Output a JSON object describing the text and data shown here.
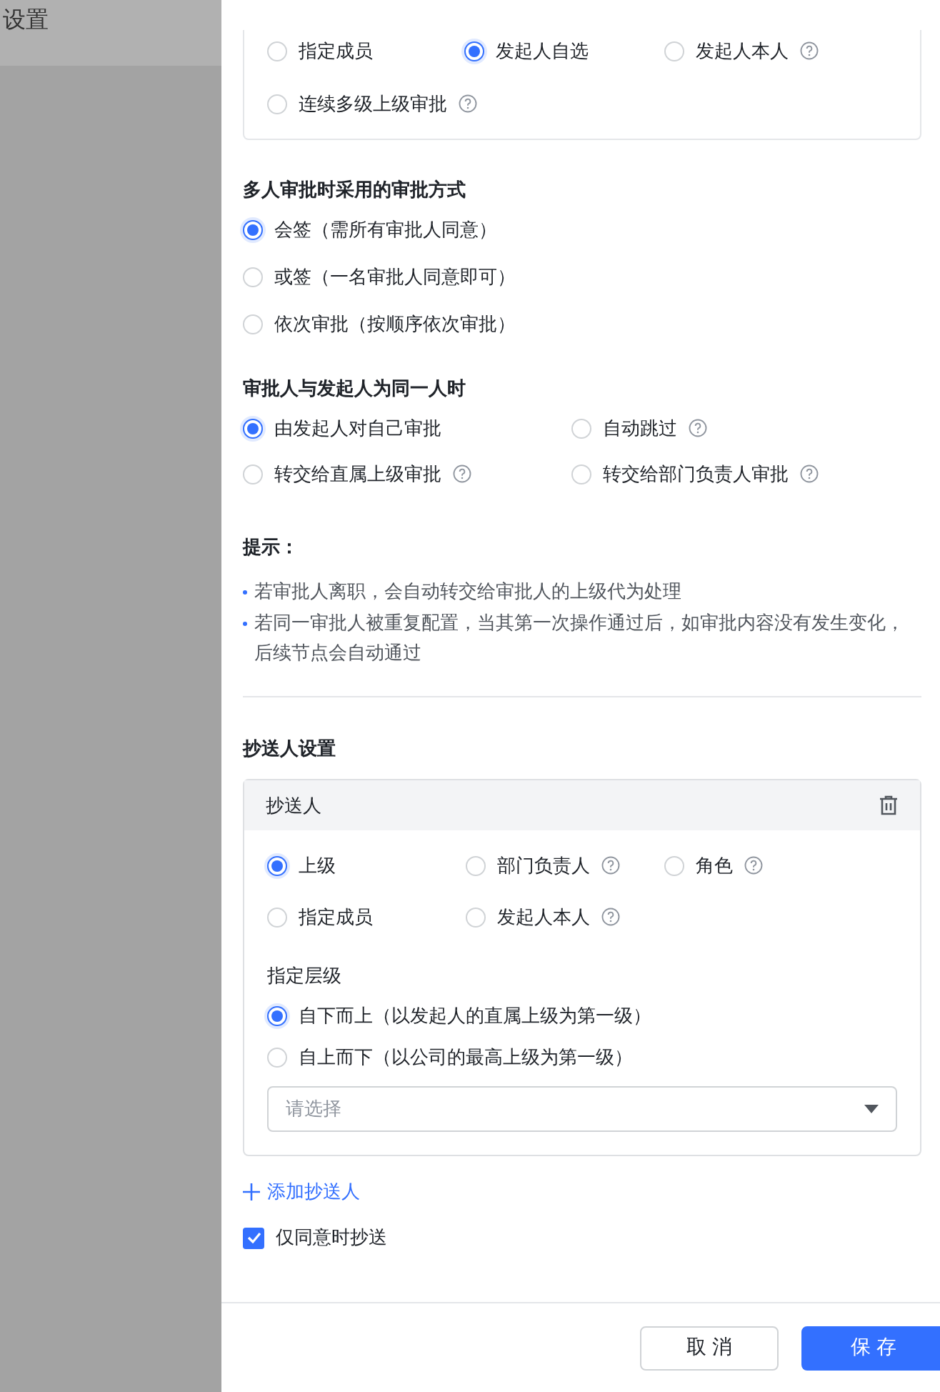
{
  "background_page": {
    "title": "设置"
  },
  "approver_types": {
    "options": [
      {
        "label": "指定成员",
        "selected": false,
        "help": false
      },
      {
        "label": "发起人自选",
        "selected": true,
        "help": false
      },
      {
        "label": "发起人本人",
        "selected": false,
        "help": true
      },
      {
        "label": "连续多级上级审批",
        "selected": false,
        "help": true
      }
    ]
  },
  "multi_approval": {
    "title": "多人审批时采用的审批方式",
    "options": [
      {
        "label": "会签（需所有审批人同意）",
        "selected": true
      },
      {
        "label": "或签（一名审批人同意即可）",
        "selected": false
      },
      {
        "label": "依次审批（按顺序依次审批）",
        "selected": false
      }
    ]
  },
  "same_person": {
    "title": "审批人与发起人为同一人时",
    "options": [
      {
        "label": "由发起人对自己审批",
        "selected": true,
        "help": false
      },
      {
        "label": "自动跳过",
        "selected": false,
        "help": true
      },
      {
        "label": "转交给直属上级审批",
        "selected": false,
        "help": true
      },
      {
        "label": "转交给部门负责人审批",
        "selected": false,
        "help": true
      }
    ]
  },
  "tips": {
    "title": "提示：",
    "items": [
      "若审批人离职，会自动转交给审批人的上级代为处理",
      "若同一审批人被重复配置，当其第一次操作通过后，如审批内容没有发生变化，后续节点会自动通过"
    ]
  },
  "cc": {
    "title": "抄送人设置",
    "card": {
      "title": "抄送人",
      "types": [
        {
          "label": "上级",
          "selected": true,
          "help": false
        },
        {
          "label": "部门负责人",
          "selected": false,
          "help": true
        },
        {
          "label": "角色",
          "selected": false,
          "help": true
        },
        {
          "label": "指定成员",
          "selected": false,
          "help": false
        },
        {
          "label": "发起人本人",
          "selected": false,
          "help": true
        }
      ],
      "level_title": "指定层级",
      "levels": [
        {
          "label": "自下而上（以发起人的直属上级为第一级）",
          "selected": true
        },
        {
          "label": "自上而下（以公司的最高上级为第一级）",
          "selected": false
        }
      ],
      "select": {
        "placeholder": "请选择"
      }
    },
    "add_link": "添加抄送人",
    "only_on_approve": {
      "label": "仅同意时抄送",
      "checked": true
    }
  },
  "footer": {
    "buttons": [
      {
        "label": "取 消",
        "kind": "secondary"
      },
      {
        "label": "保 存",
        "kind": "primary"
      }
    ]
  }
}
